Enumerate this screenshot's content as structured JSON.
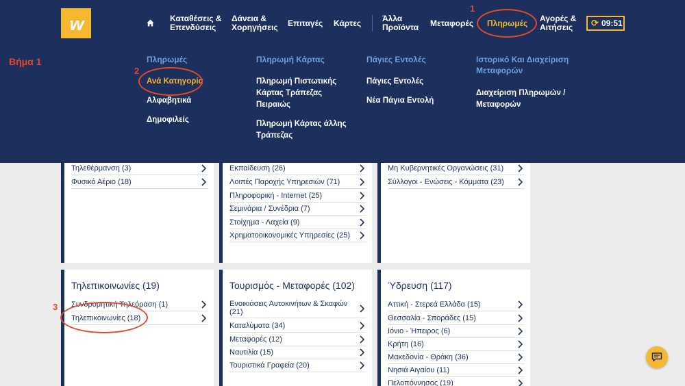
{
  "topnav": {
    "logo_letter": "w",
    "items": [
      {
        "label": "Καταθέσεις &\nΕπενδύσεις"
      },
      {
        "label": "Δάνεια &\nΧορηγήσεις"
      },
      {
        "label": "Επιταγές"
      },
      {
        "label": "Κάρτες"
      },
      {
        "label": "Άλλα\nΠροϊόντα"
      },
      {
        "label": "Μεταφορές"
      },
      {
        "label": "Πληρωμές"
      },
      {
        "label": "Αγορές &\nΑιτήσεις"
      }
    ],
    "clock": "09:51"
  },
  "mega_menu": {
    "columns": [
      {
        "heading": "Πληρωμές",
        "links": [
          "Ανά Κατηγορία",
          "Αλφαβητικά",
          "Δημοφιλείς"
        ]
      },
      {
        "heading": "Πληρωμή Κάρτας",
        "links": [
          "Πληρωμή Πιστωτικής\nΚάρτας Τράπεζας\nΠειραιώς",
          "Πληρωμή Κάρτας άλλης\nΤράπεζας"
        ]
      },
      {
        "heading": "Πάγιες Εντολές",
        "links": [
          "Πάγιες Εντολές",
          "Νέα Πάγια Εντολή"
        ]
      },
      {
        "heading": "Ιστορικό Και Διαχείριση\nΜεταφορών",
        "links": [
          "Διαχείριση Πληρωμών /\nΜεταφορών"
        ]
      }
    ]
  },
  "annotations": {
    "step": "Βήμα 1",
    "n1": "1",
    "n2": "2",
    "n3": "3"
  },
  "cards_top": [
    {
      "rows": [
        "Τηλεθέρμανση (3)",
        "Φυσικό Αέριο (18)"
      ]
    },
    {
      "rows": [
        "Εκπαίδευση (26)",
        "Λοιπές Παροχής Υπηρεσιών (71)",
        "Πληροφορική - Internet (25)",
        "Σεμινάρια / Συνέδρια (7)",
        "Στοίχημα - Λαχεία (9)",
        "Χρηματοοικονομικές Υπηρεσίες (25)"
      ]
    },
    {
      "rows": [
        "Μη Κυβερνητικές Οργανώσεις (31)",
        "Σύλλογοι - Ενώσεις - Κόμματα (23)"
      ]
    }
  ],
  "cards_bottom": [
    {
      "title": "Τηλεπικοινωνίες (19)",
      "rows": [
        "Συνδρομητική Τηλεόραση (1)",
        "Τηλεπικοινωνίες (18)"
      ]
    },
    {
      "title": "Τουρισμός - Μεταφορές (102)",
      "rows": [
        "Ενοικιάσεις Αυτοκινήτων & Σκαφών (21)",
        "Καταλύματα (34)",
        "Μεταφορές (12)",
        "Ναυτιλία (15)",
        "Τουριστικά Γραφεία (20)"
      ]
    },
    {
      "title": "Ύδρευση (117)",
      "rows": [
        "Αττική - Στερεά Ελλάδα (15)",
        "Θεσσαλία - Σποράδες (15)",
        "Ιόνιο - Ήπειρος (6)",
        "Κρήτη (16)",
        "Μακεδονία - Θράκη (36)",
        "Νησιά Αιγαίου (11)",
        "Πελοπόννησος (19)"
      ]
    }
  ]
}
